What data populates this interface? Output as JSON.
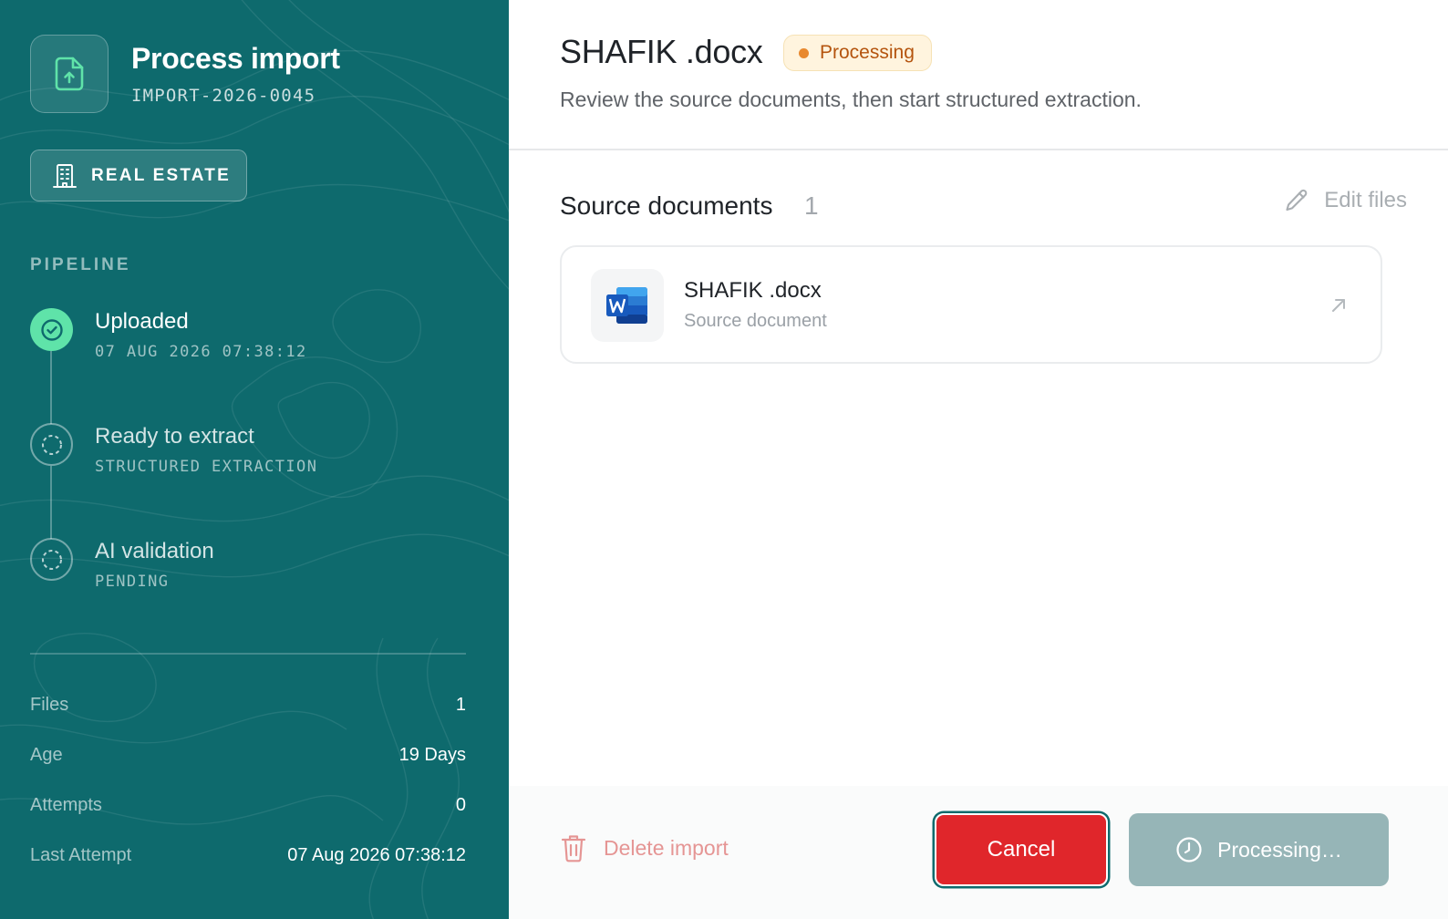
{
  "sidebar": {
    "title": "Process import",
    "import_id": "IMPORT-2026-0045",
    "category": "REAL ESTATE",
    "pipeline_label": "PIPELINE",
    "steps": [
      {
        "title": "Uploaded",
        "subtitle": "07 AUG 2026 07:38:12",
        "state": "done"
      },
      {
        "title": "Ready to extract",
        "subtitle": "STRUCTURED EXTRACTION",
        "state": "pending"
      },
      {
        "title": "AI validation",
        "subtitle": "PENDING",
        "state": "pending"
      }
    ],
    "stats": [
      {
        "label": "Files",
        "value": "1"
      },
      {
        "label": "Age",
        "value": "19 Days"
      },
      {
        "label": "Attempts",
        "value": "0"
      },
      {
        "label": "Last Attempt",
        "value": "07 Aug 2026 07:38:12"
      }
    ]
  },
  "header": {
    "doc_title": "SHAFIK .docx",
    "status": "Processing",
    "subtitle": "Review the source documents, then start structured extraction."
  },
  "sources": {
    "title": "Source documents",
    "count": "1",
    "edit_label": "Edit files",
    "files": [
      {
        "name": "SHAFIK .docx",
        "subtitle": "Source document",
        "icon": "word-doc-icon"
      }
    ]
  },
  "footer": {
    "delete_label": "Delete import",
    "cancel_label": "Cancel",
    "processing_label": "Processing…"
  },
  "colors": {
    "sidebar_bg": "#0e6a6d",
    "success": "#5fe3a9",
    "status_bg": "#fff4de",
    "status_text": "#b4540e",
    "cancel_bg": "#e0262b",
    "processing_bg": "#96b5b7",
    "delete": "#e59594"
  }
}
